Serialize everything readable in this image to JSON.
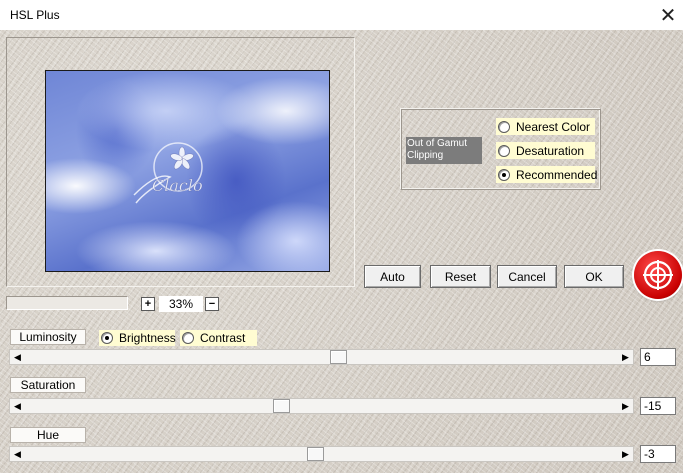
{
  "window": {
    "title": "HSL Plus",
    "close_glyph": "✕"
  },
  "preview": {
    "watermark_text": "Claclo"
  },
  "gamut": {
    "label": "Out of Gamut Clipping",
    "options": [
      {
        "label": "Nearest Color",
        "selected": false
      },
      {
        "label": "Desaturation",
        "selected": false
      },
      {
        "label": "Recommended",
        "selected": true
      }
    ]
  },
  "buttons": {
    "auto": "Auto",
    "reset": "Reset",
    "cancel": "Cancel",
    "ok": "OK"
  },
  "help_icon": "help-lifebuoy-icon",
  "zoom": {
    "plus": "+",
    "minus": "−",
    "value": "33%"
  },
  "luminosity": {
    "label": "Luminosity",
    "modes": [
      {
        "label": "Brightness",
        "selected": true
      },
      {
        "label": "Contrast",
        "selected": false
      }
    ],
    "value": "6",
    "slider_fraction": 0.53
  },
  "saturation": {
    "label": "Saturation",
    "value": "-15",
    "slider_fraction": 0.43
  },
  "hue": {
    "label": "Hue",
    "value": "-3",
    "slider_fraction": 0.49
  },
  "scroll_arrows": {
    "left": "◀",
    "right": "▶"
  },
  "colors": {
    "accent_red": "#d40000",
    "radio_bg": "#fffcd2",
    "gamut_label_bg": "#7c7c7c"
  }
}
